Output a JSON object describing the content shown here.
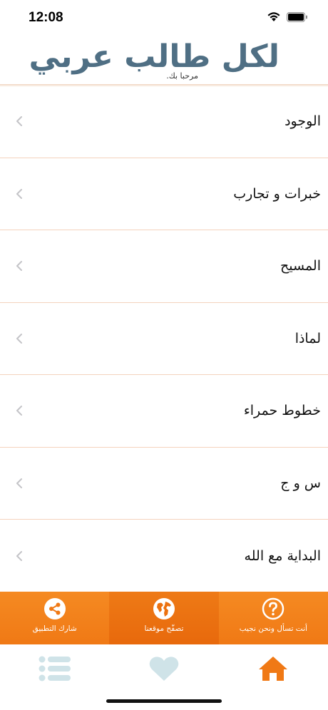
{
  "status_bar": {
    "time": "12:08"
  },
  "header": {
    "title": "لكل طالب عربي",
    "subtitle": "مرحبا بك."
  },
  "list": {
    "items": [
      {
        "label": "الوجود"
      },
      {
        "label": "خبرات و تجارب"
      },
      {
        "label": "المسيح"
      },
      {
        "label": "لماذا"
      },
      {
        "label": "خطوط حمراء"
      },
      {
        "label": "س و ج"
      },
      {
        "label": "البداية مع الله"
      }
    ]
  },
  "actions": {
    "share_label": "شارك التطبيق",
    "browse_label": "تصفّح موقعنا",
    "ask_label": "أنت تسأل ونحن نجيب"
  },
  "tabs": [
    "list-icon",
    "heart-icon",
    "home-icon"
  ],
  "colors": {
    "accent": "#f07915",
    "title": "#4f6f84",
    "tab_inactive": "#cfe3e8",
    "divider": "#f4d2bd"
  }
}
